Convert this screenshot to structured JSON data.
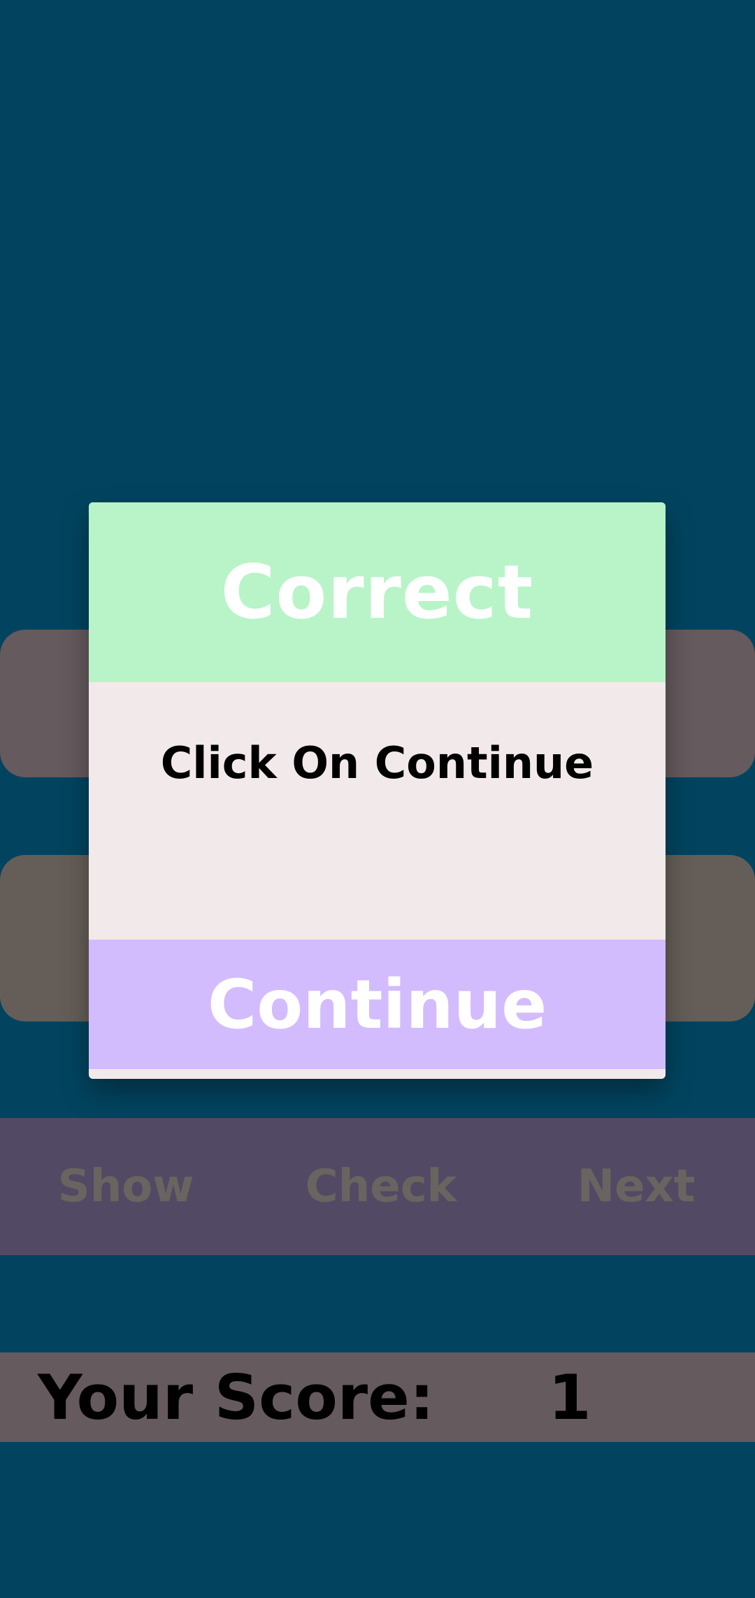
{
  "colors": {
    "background": "#02445f",
    "dialog_header": "#b8f4c8",
    "dialog_body": "#f2eaea",
    "continue_button": "#d3bcfd",
    "action_bar": "#524a64",
    "score_bar": "#655a5e"
  },
  "dialog": {
    "title": "Correct",
    "message": "Click On Continue",
    "continue_label": "Continue"
  },
  "actions": {
    "show_label": "Show",
    "check_label": "Check",
    "next_label": "Next"
  },
  "score": {
    "label": "Your Score:",
    "value": "1"
  }
}
